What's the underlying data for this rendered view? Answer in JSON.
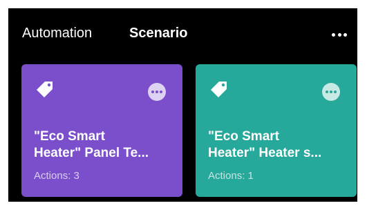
{
  "header": {
    "tabs": [
      {
        "label": "Automation",
        "active": false
      },
      {
        "label": "Scenario",
        "active": true
      }
    ],
    "more_icon": "more-horizontal-icon"
  },
  "cards": [
    {
      "icon": "tag-icon",
      "title": "\"Eco Smart\nHeater\" Panel Te...",
      "subtitle": "Actions: 3",
      "color": "#7b4ecb"
    },
    {
      "icon": "tag-icon",
      "title": "\"Eco Smart\nHeater\" Heater s...",
      "subtitle": "Actions: 1",
      "color": "#26a89a"
    }
  ],
  "colors": {
    "background": "#000000",
    "text": "#ffffff"
  }
}
